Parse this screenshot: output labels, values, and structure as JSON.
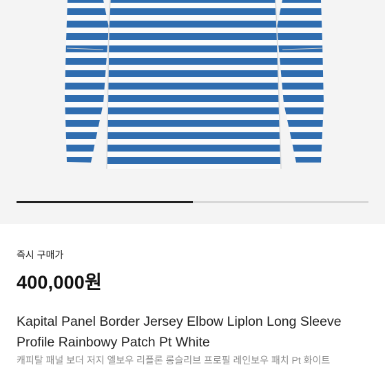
{
  "product": {
    "image_alt": "Kapital Panel Border Jersey striped long sleeve shirt",
    "stripe_colors": {
      "blue": "#2f6db0",
      "white": "#fbfbfb"
    },
    "carousel_progress": 0.5,
    "price_label": "즉시 구매가",
    "price": "400,000원",
    "title": "Kapital Panel Border Jersey Elbow Liplon Long Sleeve Profile Rainbowy Patch Pt White",
    "subtitle": "캐피탈 패널 보더 저지 엘보우 리플론 롱슬리브 프로필 레인보우 패치 Pt 화이트"
  }
}
